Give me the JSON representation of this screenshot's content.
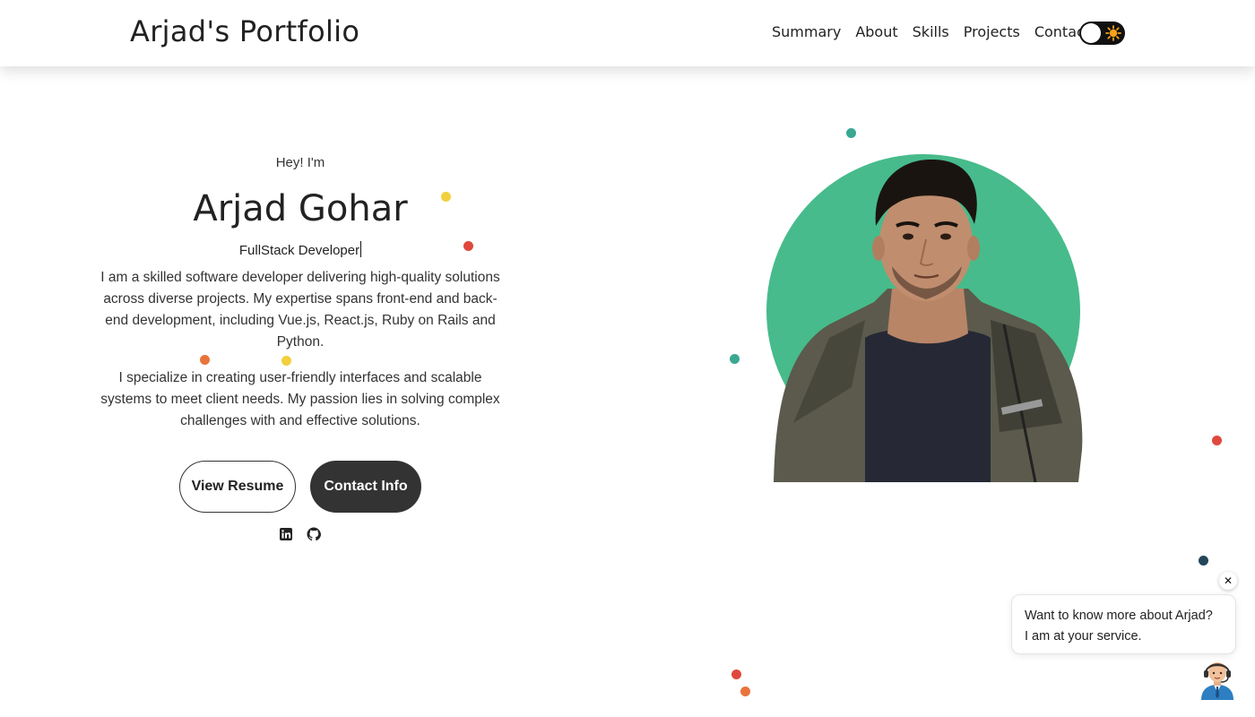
{
  "header": {
    "brand": "Arjad's Portfolio",
    "nav": [
      "Summary",
      "About",
      "Skills",
      "Projects",
      "Contact"
    ],
    "theme_toggle_icon": "sun-icon"
  },
  "hero": {
    "greeting": "Hey! I'm",
    "name": "Arjad Gohar",
    "role": "FullStack Developer",
    "paragraph1": "I am a skilled software developer delivering high-quality solutions across diverse projects. My expertise spans front-end and back-end development, including Vue.js, React.js, Ruby on Rails and Python.",
    "paragraph2": "I specialize in creating user-friendly interfaces and scalable systems to meet client needs. My passion lies in solving complex challenges with and effective solutions.",
    "buttons": {
      "resume": "View Resume",
      "contact": "Contact Info"
    },
    "social_icons": [
      "linkedin-icon",
      "github-icon"
    ]
  },
  "chat": {
    "line1": "Want to know more about Arjad?",
    "line2": "I am at your service.",
    "close": "✕"
  },
  "colors": {
    "accent_green": "#47bb8b",
    "button_dark": "#333333",
    "dot_teal": "#3aa892",
    "dot_yellow": "#f2cf3d",
    "dot_red": "#e0483d",
    "dot_orange": "#e8743b",
    "dot_navy": "#23465a"
  }
}
